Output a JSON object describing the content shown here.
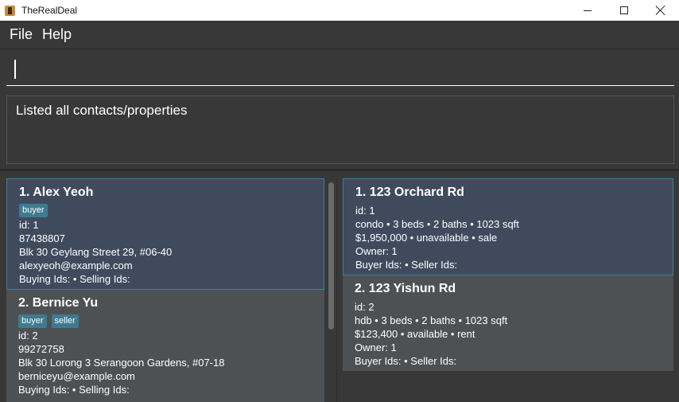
{
  "window": {
    "title": "TheRealDeal"
  },
  "menu": {
    "file": "File",
    "help": "Help"
  },
  "command": {
    "value": ""
  },
  "result": {
    "text": "Listed all contacts/properties"
  },
  "contacts": [
    {
      "title": "1. Alex Yeoh",
      "tags": [
        "buyer"
      ],
      "id": "id: 1",
      "phone": "87438807",
      "address": "Blk 30 Geylang Street 29, #06-40",
      "email": "alexyeoh@example.com",
      "ids": "Buying Ids:  • Selling Ids:"
    },
    {
      "title": "2. Bernice Yu",
      "tags": [
        "buyer",
        "seller"
      ],
      "id": "id: 2",
      "phone": "99272758",
      "address": "Blk 30 Lorong 3 Serangoon Gardens, #07-18",
      "email": "berniceyu@example.com",
      "ids": "Buying Ids:  • Selling Ids:"
    }
  ],
  "properties": [
    {
      "title": "1. 123 Orchard Rd",
      "id": "id: 1",
      "details": "condo • 3 beds • 2 baths • 1023 sqft",
      "price": "$1,950,000 • unavailable • sale",
      "owner": "Owner: 1",
      "ids": "Buyer Ids:  • Seller Ids:"
    },
    {
      "title": "2. 123 Yishun Rd",
      "id": "id: 2",
      "details": "hdb • 3 beds • 2 baths • 1023 sqft",
      "price": "$123,400 • available • rent",
      "owner": "Owner: 1",
      "ids": "Buyer Ids:  • Seller Ids:"
    }
  ],
  "colors": {
    "background": "#383838",
    "selected_card": "#3f4b5d",
    "card": "#4e5153",
    "tag": "#3e7b91",
    "selection_border": "#3b7e99"
  }
}
